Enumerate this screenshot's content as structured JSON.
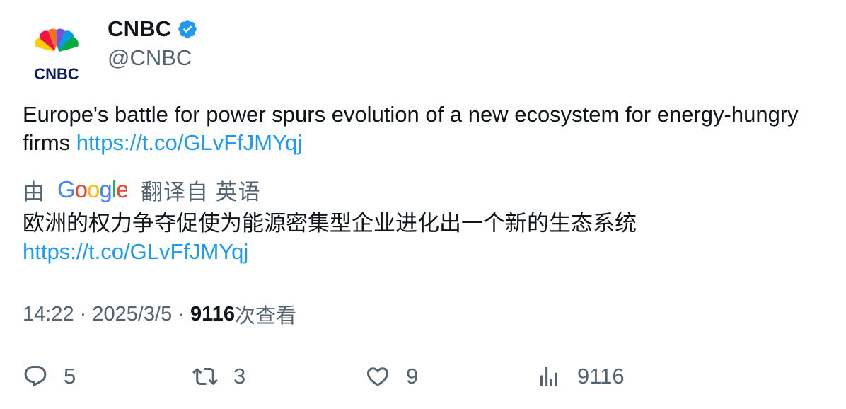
{
  "author": {
    "display_name": "CNBC",
    "handle": "@CNBC",
    "verified": true,
    "avatar_logo_text": "CNBC",
    "verified_color": "#1d9bf0"
  },
  "tweet": {
    "text": "Europe's battle for power spurs evolution of a new ecosystem for energy-hungry firms ",
    "link": "https://t.co/GLvFfJMYqj"
  },
  "translation": {
    "by_label": "由",
    "provider": "Google",
    "from_label": "翻译自 英语",
    "text": "欧洲的权力争夺促使为能源密集型企业进化出一个新的生态系统",
    "link": "https://t.co/GLvFfJMYqj"
  },
  "meta": {
    "time": "14:22",
    "separator": " · ",
    "date": "2025/3/5",
    "views_count": "9116",
    "views_label": "次查看"
  },
  "actions": {
    "replies": "5",
    "retweets": "3",
    "likes": "9",
    "views": "9116"
  },
  "colors": {
    "link": "#1d9bf0",
    "secondary_text": "#536471",
    "primary_text": "#0f1419"
  }
}
